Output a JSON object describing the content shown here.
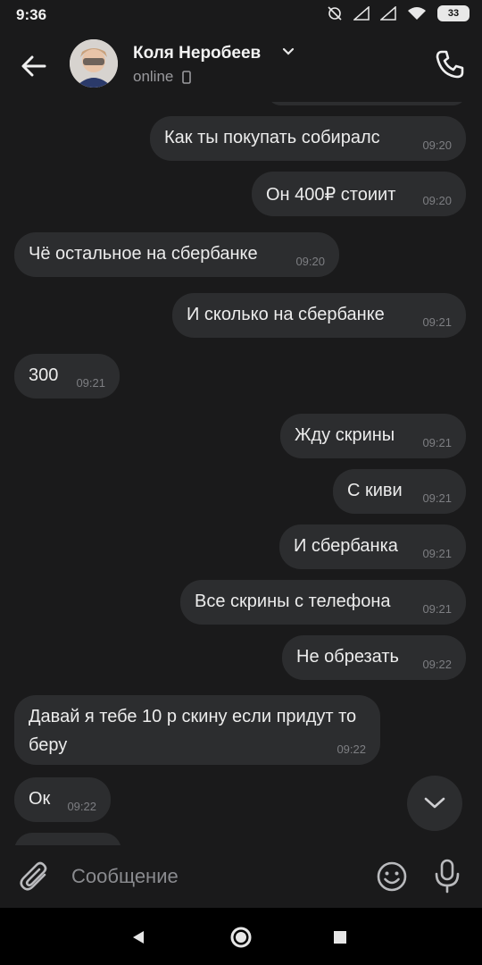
{
  "status_bar": {
    "time": "9:36",
    "battery": "33"
  },
  "header": {
    "name": "Коля Неробеев",
    "status": "online"
  },
  "messages": [
    {
      "text": "Как ты покупать собиралс",
      "time": "09:20",
      "side": "out"
    },
    {
      "text": "Он 400₽ стоиит",
      "time": "09:20",
      "side": "out"
    },
    {
      "text": "Чё остальное на сбербанке",
      "time": "09:20",
      "side": "in"
    },
    {
      "text": "И сколько на сбербанке",
      "time": "09:21",
      "side": "out"
    },
    {
      "text": "300",
      "time": "09:21",
      "side": "in"
    },
    {
      "text": "Жду скрины",
      "time": "09:21",
      "side": "out"
    },
    {
      "text": "С киви",
      "time": "09:21",
      "side": "out"
    },
    {
      "text": "И сбербанка",
      "time": "09:21",
      "side": "out"
    },
    {
      "text": "Все скрины с телефона",
      "time": "09:21",
      "side": "out"
    },
    {
      "text": "Не обрезать",
      "time": "09:22",
      "side": "out"
    },
    {
      "text": "Давай я тебе 10 р скину если придут то беру",
      "time": "09:22",
      "side": "in"
    },
    {
      "text": "Ок",
      "time": "09:22",
      "side": "in"
    }
  ],
  "composer": {
    "placeholder": "Сообщение"
  },
  "colors": {
    "background": "#1a1a1b",
    "bubble": "#2c2d2f",
    "text": "#ececec",
    "muted": "#7d7e82"
  }
}
